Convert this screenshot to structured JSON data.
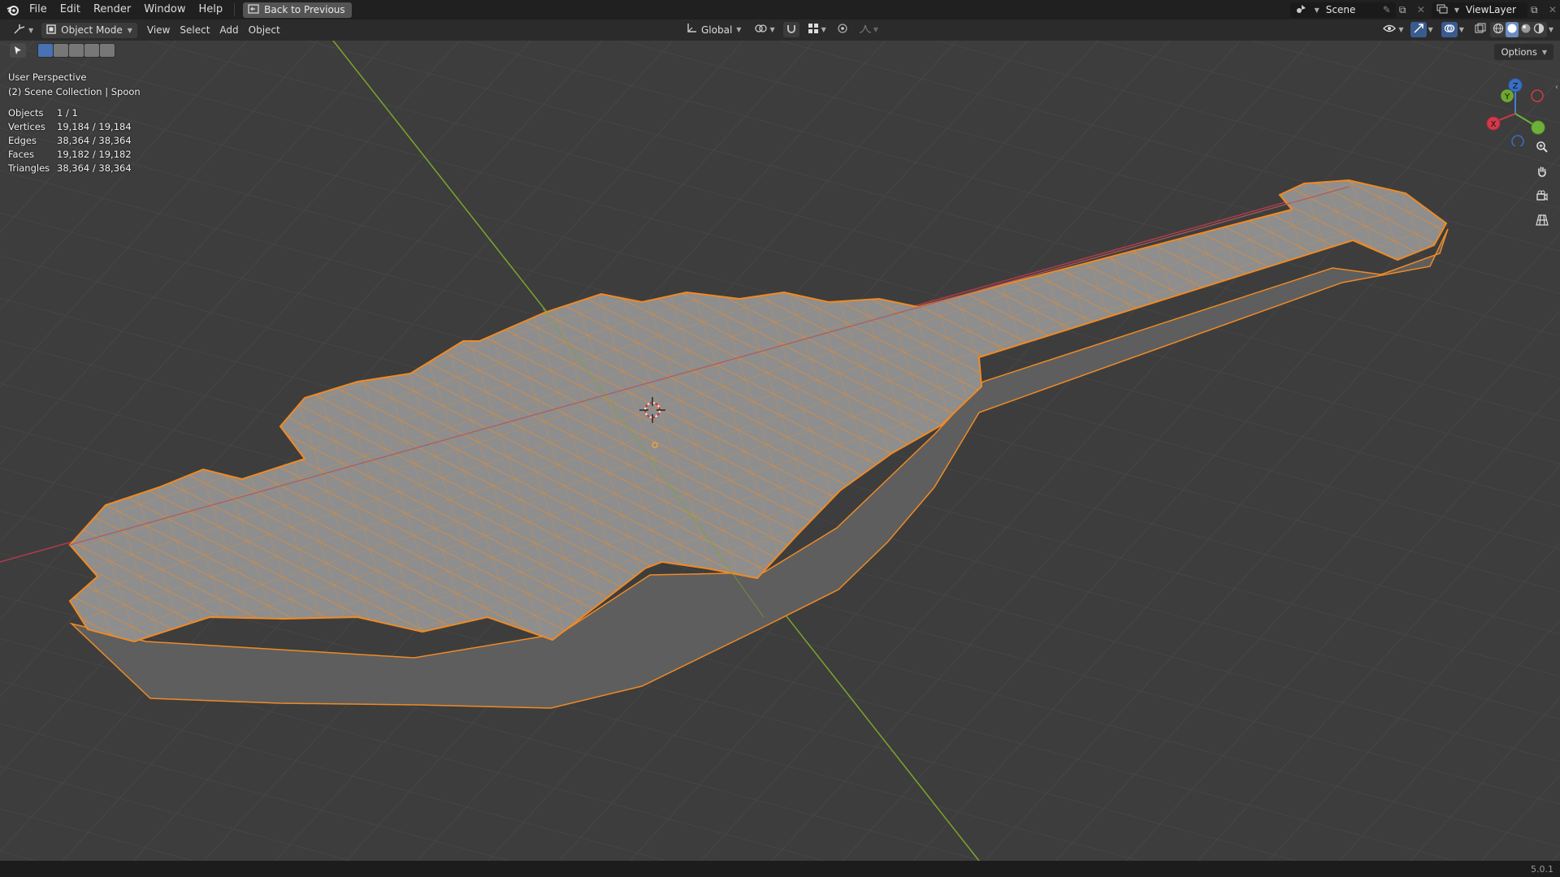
{
  "topbar": {
    "menus": [
      "File",
      "Edit",
      "Render",
      "Window",
      "Help"
    ],
    "back_label": "Back to Previous",
    "scene_name": "Scene",
    "viewlayer_name": "ViewLayer"
  },
  "header": {
    "mode_label": "Object Mode",
    "menus": [
      "View",
      "Select",
      "Add",
      "Object"
    ],
    "transform_orientation": "Global"
  },
  "viewport": {
    "perspective_label": "User Perspective",
    "collection_label": "(2) Scene Collection | Spoon",
    "options_label": "Options",
    "stats": [
      {
        "label": "Objects",
        "value": "1 / 1"
      },
      {
        "label": "Vertices",
        "value": "19,184 / 19,184"
      },
      {
        "label": "Edges",
        "value": "38,364 / 38,364"
      },
      {
        "label": "Faces",
        "value": "19,182 / 19,182"
      },
      {
        "label": "Triangles",
        "value": "38,364 / 38,364"
      }
    ],
    "gizmo": {
      "x_label": "X",
      "y_label": "Y",
      "z_label": "Z"
    },
    "colors": {
      "selection": "#f08a24",
      "x_axis": "#d03a4a",
      "y_axis": "#7aa52a",
      "z_axis": "#3a7ad0",
      "mesh": "#8c8c8c"
    }
  },
  "statusbar": {
    "version": "5.0.1"
  }
}
